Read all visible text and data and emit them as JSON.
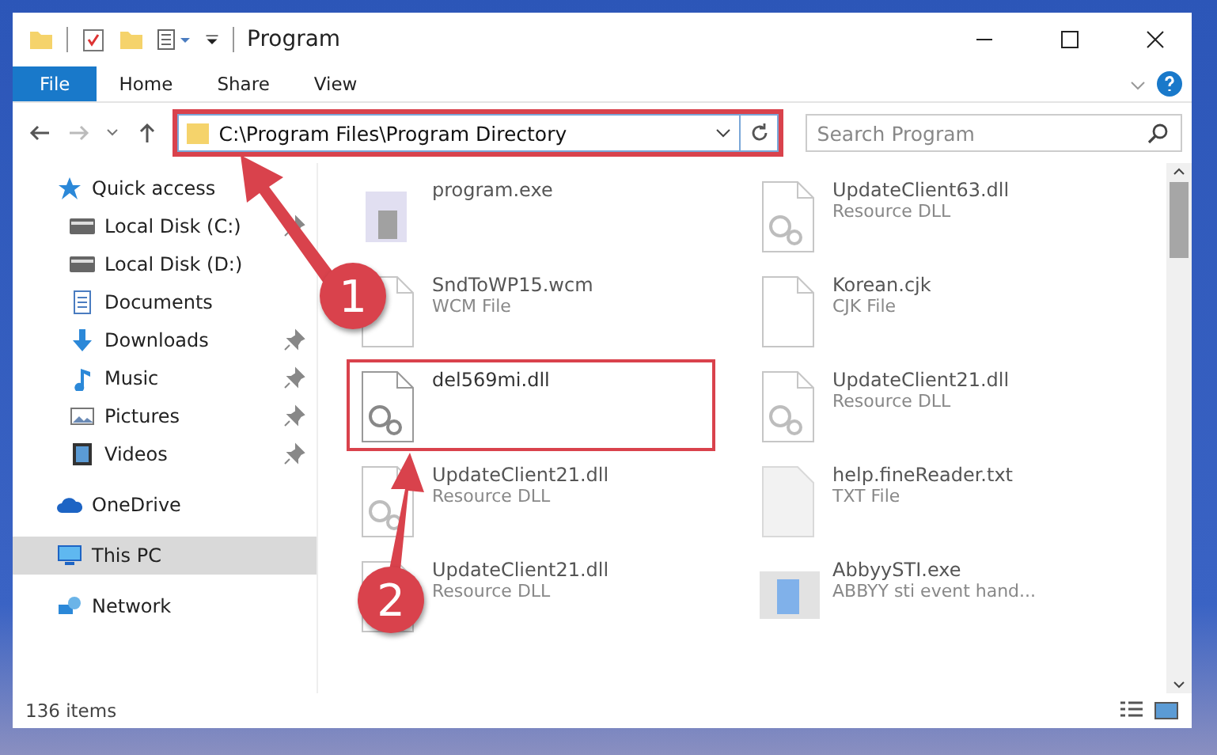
{
  "window": {
    "title": "Program"
  },
  "ribbon_tabs": [
    {
      "label": "File",
      "kind": "file",
      "selected": false
    },
    {
      "label": "Home",
      "kind": "tab",
      "selected": false
    },
    {
      "label": "Share",
      "kind": "tab",
      "selected": false
    },
    {
      "label": "View",
      "kind": "tab",
      "selected": false
    }
  ],
  "address": {
    "path": "C:\\Program Files\\Program Directory",
    "highlighted": true
  },
  "search": {
    "placeholder": "Search Program"
  },
  "nav_pane": {
    "items": [
      {
        "label": "Quick access",
        "kind": "star",
        "selected": false,
        "pinned": false,
        "children": [
          {
            "label": "Local Disk (C:)",
            "kind": "drive",
            "selected": false,
            "pinned": true
          },
          {
            "label": "Local Disk (D:)",
            "kind": "drive",
            "selected": false,
            "pinned": false
          },
          {
            "label": "Documents",
            "kind": "document",
            "selected": false,
            "pinned": false
          },
          {
            "label": "Downloads",
            "kind": "download",
            "selected": false,
            "pinned": true
          },
          {
            "label": "Music",
            "kind": "music",
            "selected": false,
            "pinned": true
          },
          {
            "label": "Pictures",
            "kind": "picture",
            "selected": false,
            "pinned": true
          },
          {
            "label": "Videos",
            "kind": "video",
            "selected": false,
            "pinned": true
          }
        ]
      },
      {
        "label": "OneDrive",
        "kind": "cloud",
        "selected": false,
        "pinned": false
      },
      {
        "label": "This PC",
        "kind": "pc",
        "selected": true,
        "pinned": false
      },
      {
        "label": "Network",
        "kind": "network",
        "selected": false,
        "pinned": false
      }
    ]
  },
  "files": [
    {
      "name": "program.exe",
      "kind": "exe",
      "blurred": true,
      "highlighted": false
    },
    {
      "name": "UpdateClient63.dll",
      "type": "Resource DLL",
      "kind": "dll",
      "blurred": true,
      "highlighted": false
    },
    {
      "name": "SndToWP15.wcm",
      "type": "WCM File",
      "kind": "file",
      "blurred": true,
      "highlighted": false
    },
    {
      "name": "Korean.cjk",
      "type": "CJK File",
      "kind": "file",
      "blurred": true,
      "highlighted": false
    },
    {
      "name": "del569mi.dll",
      "kind": "dll",
      "blurred": false,
      "highlighted": true
    },
    {
      "name": "UpdateClient21.dll",
      "type": "Resource DLL",
      "kind": "dll",
      "blurred": true,
      "highlighted": false
    },
    {
      "name": "UpdateClient21.dll",
      "type": "Resource DLL",
      "kind": "dll",
      "blurred": true,
      "highlighted": false
    },
    {
      "name": "help.fineReader.txt",
      "type": "TXT File",
      "kind": "text",
      "blurred": true,
      "highlighted": false
    },
    {
      "name": "UpdateClient21.dll",
      "type": "Resource DLL",
      "kind": "dll",
      "blurred": true,
      "highlighted": false
    },
    {
      "name": "AbbyySTI.exe",
      "type": "ABBYY sti event hand...",
      "kind": "app",
      "blurred": true,
      "highlighted": false
    }
  ],
  "annotations": [
    {
      "label": "1"
    },
    {
      "label": "2"
    }
  ],
  "status_bar": {
    "item_count": "136 items"
  }
}
